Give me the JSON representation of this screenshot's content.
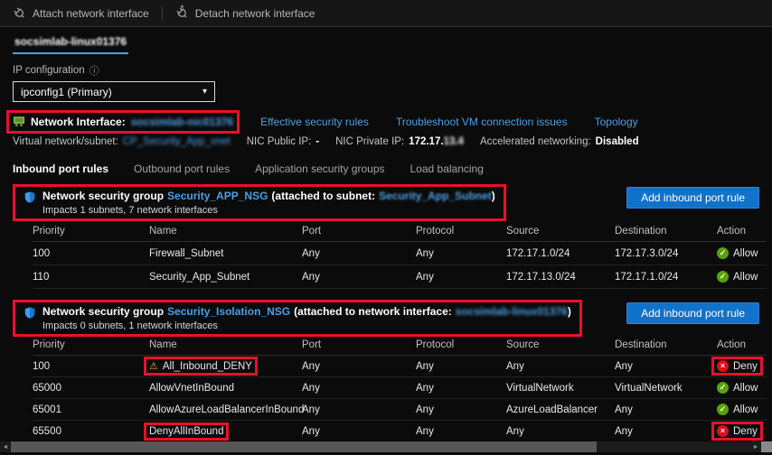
{
  "toolbar": {
    "attach_label": "Attach network interface",
    "detach_label": "Detach network interface"
  },
  "nic_tab_label": "socsimlab-linux01376",
  "ip_configuration": {
    "label": "IP configuration",
    "selected": "ipconfig1 (Primary)"
  },
  "interface_bar": {
    "label": "Network Interface:",
    "name": "socsimlab-nic01376",
    "links": {
      "effective": "Effective security rules",
      "troubleshoot": "Troubleshoot VM connection issues",
      "topology": "Topology"
    }
  },
  "network_info": {
    "vnet_label": "Virtual network/subnet:",
    "vnet_value": "CP_Security_App_vnet",
    "public_ip_label": "NIC Public IP:",
    "public_ip_value": "-",
    "private_ip_label": "NIC Private IP:",
    "private_ip_prefix": "172.17.",
    "private_ip_suffix": "13.4",
    "accel_label": "Accelerated networking:",
    "accel_value": "Disabled"
  },
  "tabs": [
    {
      "label": "Inbound port rules",
      "active": true
    },
    {
      "label": "Outbound port rules",
      "active": false
    },
    {
      "label": "Application security groups",
      "active": false
    },
    {
      "label": "Load balancing",
      "active": false
    }
  ],
  "nsg1": {
    "prefix": "Network security group",
    "name": "Security_APP_NSG",
    "middle": "(attached to subnet:",
    "subnet": "Security_App_Subnet",
    "suffix": ")",
    "impacts": "Impacts 1 subnets, 7 network interfaces",
    "add_button": "Add inbound port rule",
    "columns": [
      "Priority",
      "Name",
      "Port",
      "Protocol",
      "Source",
      "Destination",
      "Action"
    ],
    "rows": [
      {
        "priority": "100",
        "name": "Firewall_Subnet",
        "warn": false,
        "port": "Any",
        "protocol": "Any",
        "source": "172.17.1.0/24",
        "destination": "172.17.3.0/24",
        "action": "Allow"
      },
      {
        "priority": "110",
        "name": "Security_App_Subnet",
        "warn": false,
        "port": "Any",
        "protocol": "Any",
        "source": "172.17.13.0/24",
        "destination": "172.17.1.0/24",
        "action": "Allow"
      }
    ]
  },
  "nsg2": {
    "prefix": "Network security group",
    "name": "Security_Isolation_NSG",
    "middle": "(attached to network interface:",
    "nic": "socsimlab-linux01376",
    "suffix": ")",
    "impacts": "Impacts 0 subnets, 1 network interfaces",
    "add_button": "Add inbound port rule",
    "columns": [
      "Priority",
      "Name",
      "Port",
      "Protocol",
      "Source",
      "Destination",
      "Action"
    ],
    "rows": [
      {
        "priority": "100",
        "name": "All_Inbound_DENY",
        "warn": true,
        "port": "Any",
        "protocol": "Any",
        "source": "Any",
        "destination": "Any",
        "action": "Deny"
      },
      {
        "priority": "65000",
        "name": "AllowVnetInBound",
        "warn": false,
        "port": "Any",
        "protocol": "Any",
        "source": "VirtualNetwork",
        "destination": "VirtualNetwork",
        "action": "Allow"
      },
      {
        "priority": "65001",
        "name": "AllowAzureLoadBalancerInBound",
        "warn": false,
        "port": "Any",
        "protocol": "Any",
        "source": "AzureLoadBalancer",
        "destination": "Any",
        "action": "Allow"
      },
      {
        "priority": "65500",
        "name": "DenyAllInBound",
        "warn": false,
        "port": "Any",
        "protocol": "Any",
        "source": "Any",
        "destination": "Any",
        "action": "Deny"
      }
    ]
  },
  "colors": {
    "accent_blue": "#1172c9",
    "link_blue": "#4b9fe4",
    "allow_green": "#57a300",
    "deny_red": "#e00b1c",
    "warning_orange": "#fcaa1b",
    "annotation_red": "#e8112d"
  }
}
